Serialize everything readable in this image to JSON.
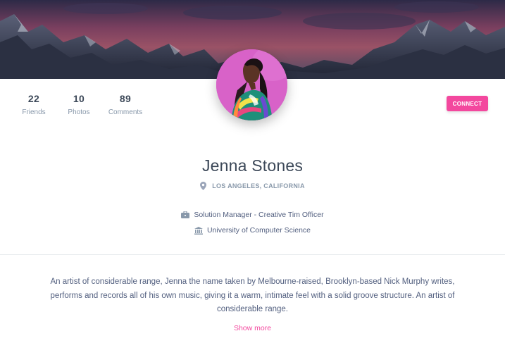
{
  "profile": {
    "stats": [
      {
        "value": "22",
        "label": "Friends"
      },
      {
        "value": "10",
        "label": "Photos"
      },
      {
        "value": "89",
        "label": "Comments"
      }
    ],
    "connect_label": "CONNECT",
    "name": "Jenna Stones",
    "location": "LOS ANGELES, CALIFORNIA",
    "job": "Solution Manager - Creative Tim Officer",
    "education": "University of Computer Science",
    "bio": "An artist of considerable range, Jenna the name taken by Melbourne-raised, Brooklyn-based Nick Murphy writes, performs and records all of his own music, giving it a warm, intimate feel with a solid groove structure. An artist of considerable range.",
    "show_more_label": "Show more"
  },
  "icons": {
    "location": "map-marker-icon",
    "job": "briefcase-icon",
    "education": "university-icon"
  },
  "colors": {
    "accent": "#f3489e",
    "text": "#3c4858",
    "muted": "#8898aa",
    "avatar_bg": "#d862c8"
  }
}
